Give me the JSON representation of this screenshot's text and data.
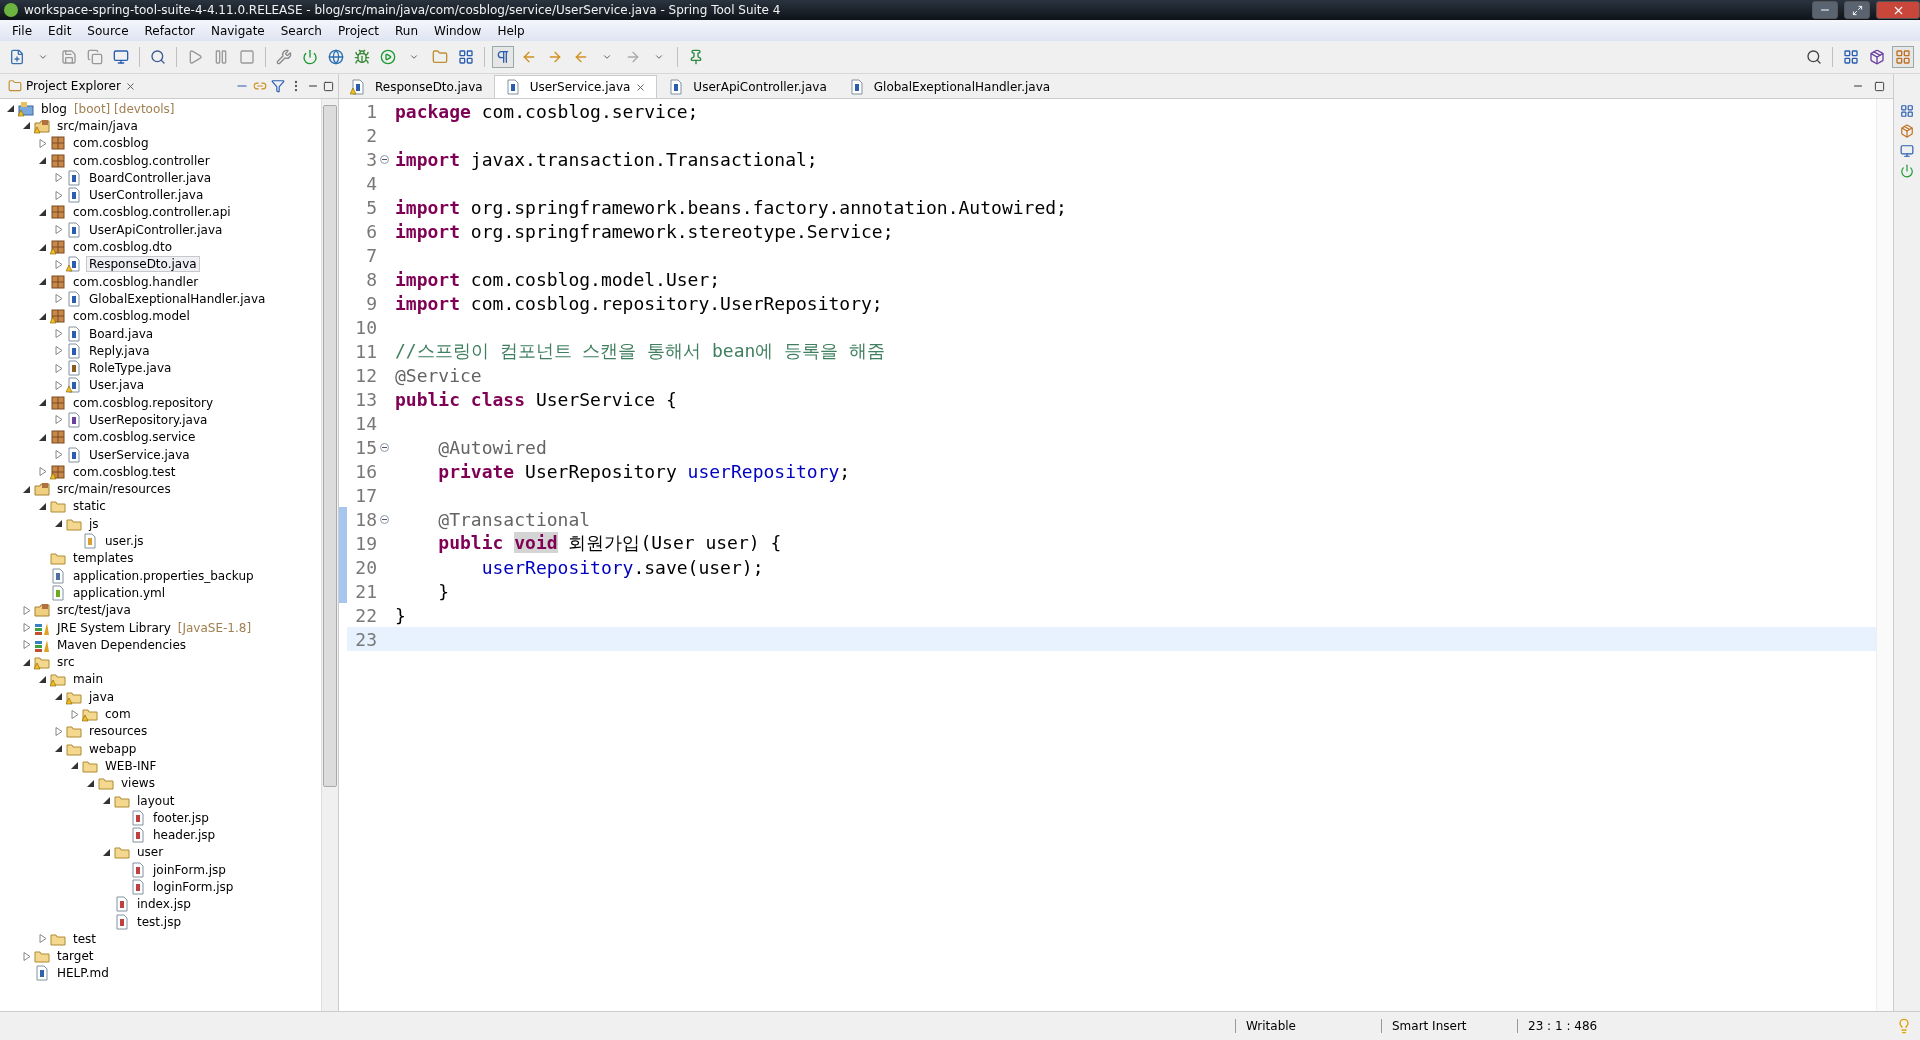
{
  "window": {
    "title": "workspace-spring-tool-suite-4-4.11.0.RELEASE - blog/src/main/java/com/cosblog/service/UserService.java - Spring Tool Suite 4"
  },
  "menu": [
    "File",
    "Edit",
    "Source",
    "Refactor",
    "Navigate",
    "Search",
    "Project",
    "Run",
    "Window",
    "Help"
  ],
  "explorer": {
    "title": "Project Explorer",
    "tree": [
      {
        "label": "blog",
        "suffix": "[boot] [devtools]",
        "kind": "project",
        "expanded": true,
        "warning": true,
        "selected": false,
        "children": [
          {
            "label": "src/main/java",
            "kind": "source",
            "expanded": true,
            "warning": true,
            "selected": false,
            "children": [
              {
                "label": "com.cosblog",
                "kind": "package",
                "expanded": false,
                "warning": false,
                "selected": false
              },
              {
                "label": "com.cosblog.controller",
                "kind": "package",
                "expanded": true,
                "warning": false,
                "selected": false,
                "children": [
                  {
                    "label": "BoardController.java",
                    "kind": "java",
                    "expanded": false,
                    "warning": false,
                    "selected": false
                  },
                  {
                    "label": "UserController.java",
                    "kind": "java",
                    "expanded": false,
                    "warning": false,
                    "selected": false
                  }
                ]
              },
              {
                "label": "com.cosblog.controller.api",
                "kind": "package",
                "expanded": true,
                "warning": false,
                "selected": false,
                "children": [
                  {
                    "label": "UserApiController.java",
                    "kind": "java",
                    "expanded": false,
                    "warning": false,
                    "selected": false
                  }
                ]
              },
              {
                "label": "com.cosblog.dto",
                "kind": "package",
                "expanded": true,
                "warning": true,
                "selected": false,
                "children": [
                  {
                    "label": "ResponseDto.java",
                    "kind": "java",
                    "expanded": false,
                    "warning": true,
                    "selected": true
                  }
                ]
              },
              {
                "label": "com.cosblog.handler",
                "kind": "package",
                "expanded": true,
                "warning": false,
                "selected": false,
                "children": [
                  {
                    "label": "GlobalExeptionalHandler.java",
                    "kind": "java",
                    "expanded": false,
                    "warning": false,
                    "selected": false
                  }
                ]
              },
              {
                "label": "com.cosblog.model",
                "kind": "package",
                "expanded": true,
                "warning": true,
                "selected": false,
                "children": [
                  {
                    "label": "Board.java",
                    "kind": "java",
                    "expanded": false,
                    "warning": false,
                    "selected": false
                  },
                  {
                    "label": "Reply.java",
                    "kind": "java",
                    "expanded": false,
                    "warning": false,
                    "selected": false
                  },
                  {
                    "label": "RoleType.java",
                    "kind": "enum",
                    "expanded": false,
                    "warning": false,
                    "selected": false
                  },
                  {
                    "label": "User.java",
                    "kind": "java",
                    "expanded": false,
                    "warning": true,
                    "selected": false
                  }
                ]
              },
              {
                "label": "com.cosblog.repository",
                "kind": "package",
                "expanded": true,
                "warning": false,
                "selected": false,
                "children": [
                  {
                    "label": "UserRepository.java",
                    "kind": "interface",
                    "expanded": false,
                    "warning": false,
                    "selected": false
                  }
                ]
              },
              {
                "label": "com.cosblog.service",
                "kind": "package",
                "expanded": true,
                "warning": false,
                "selected": false,
                "children": [
                  {
                    "label": "UserService.java",
                    "kind": "java",
                    "expanded": false,
                    "warning": false,
                    "selected": false
                  }
                ]
              },
              {
                "label": "com.cosblog.test",
                "kind": "package",
                "expanded": false,
                "warning": true,
                "selected": false
              }
            ]
          },
          {
            "label": "src/main/resources",
            "kind": "source",
            "expanded": true,
            "warning": false,
            "selected": false,
            "children": [
              {
                "label": "static",
                "kind": "folder",
                "expanded": true,
                "warning": false,
                "selected": false,
                "children": [
                  {
                    "label": "js",
                    "kind": "folder",
                    "expanded": true,
                    "warning": false,
                    "selected": false,
                    "children": [
                      {
                        "label": "user.js",
                        "kind": "js",
                        "warning": false,
                        "selected": false
                      }
                    ]
                  }
                ]
              },
              {
                "label": "templates",
                "kind": "folder",
                "warning": false,
                "selected": false
              },
              {
                "label": "application.properties_backup",
                "kind": "text",
                "warning": false,
                "selected": false
              },
              {
                "label": "application.yml",
                "kind": "yml",
                "warning": false,
                "selected": false
              }
            ]
          },
          {
            "label": "src/test/java",
            "kind": "source",
            "expanded": false,
            "warning": false,
            "selected": false
          },
          {
            "label": "JRE System Library",
            "suffix": "[JavaSE-1.8]",
            "kind": "library",
            "expanded": false,
            "warning": false,
            "selected": false
          },
          {
            "label": "Maven Dependencies",
            "kind": "library",
            "expanded": false,
            "warning": false,
            "selected": false
          },
          {
            "label": "src",
            "kind": "folder",
            "expanded": true,
            "warning": true,
            "selected": false,
            "children": [
              {
                "label": "main",
                "kind": "folder",
                "expanded": true,
                "warning": true,
                "selected": false,
                "children": [
                  {
                    "label": "java",
                    "kind": "folder",
                    "expanded": true,
                    "warning": true,
                    "selected": false,
                    "children": [
                      {
                        "label": "com",
                        "kind": "folder",
                        "expanded": false,
                        "warning": true,
                        "selected": false
                      }
                    ]
                  },
                  {
                    "label": "resources",
                    "kind": "folder",
                    "expanded": false,
                    "warning": false,
                    "selected": false
                  },
                  {
                    "label": "webapp",
                    "kind": "folder",
                    "expanded": true,
                    "warning": false,
                    "selected": false,
                    "children": [
                      {
                        "label": "WEB-INF",
                        "kind": "folder",
                        "expanded": true,
                        "warning": false,
                        "selected": false,
                        "children": [
                          {
                            "label": "views",
                            "kind": "folder",
                            "expanded": true,
                            "warning": false,
                            "selected": false,
                            "children": [
                              {
                                "label": "layout",
                                "kind": "folder",
                                "expanded": true,
                                "warning": false,
                                "selected": false,
                                "children": [
                                  {
                                    "label": "footer.jsp",
                                    "kind": "jsp",
                                    "warning": false,
                                    "selected": false
                                  },
                                  {
                                    "label": "header.jsp",
                                    "kind": "jsp",
                                    "warning": false,
                                    "selected": false
                                  }
                                ]
                              },
                              {
                                "label": "user",
                                "kind": "folder",
                                "expanded": true,
                                "warning": false,
                                "selected": false,
                                "children": [
                                  {
                                    "label": "joinForm.jsp",
                                    "kind": "jsp",
                                    "warning": false,
                                    "selected": false
                                  },
                                  {
                                    "label": "loginForm.jsp",
                                    "kind": "jsp",
                                    "warning": false,
                                    "selected": false
                                  }
                                ]
                              },
                              {
                                "label": "index.jsp",
                                "kind": "jsp",
                                "warning": false,
                                "selected": false
                              },
                              {
                                "label": "test.jsp",
                                "kind": "jsp",
                                "warning": false,
                                "selected": false
                              }
                            ]
                          }
                        ]
                      }
                    ]
                  }
                ]
              },
              {
                "label": "test",
                "kind": "folder",
                "expanded": false,
                "warning": false,
                "selected": false
              }
            ]
          },
          {
            "label": "target",
            "kind": "folder",
            "expanded": false,
            "warning": false,
            "selected": false
          },
          {
            "label": "HELP.md",
            "kind": "md",
            "warning": false,
            "selected": false
          }
        ]
      }
    ]
  },
  "tabs": [
    {
      "label": "ResponseDto.java",
      "selected": false,
      "warning": true
    },
    {
      "label": "UserService.java",
      "selected": true,
      "warning": false
    },
    {
      "label": "UserApiController.java",
      "selected": false,
      "warning": false
    },
    {
      "label": "GlobalExeptionalHandler.java",
      "selected": false,
      "warning": false
    }
  ],
  "code": [
    {
      "number": "1",
      "tokens": [
        {
          "kind": "keyword",
          "text": "package"
        },
        {
          "kind": "plain",
          "text": " com.cosblog.service;"
        }
      ]
    },
    {
      "number": "2"
    },
    {
      "number": "3",
      "fold": true,
      "tokens": [
        {
          "kind": "keyword",
          "text": "import"
        },
        {
          "kind": "plain",
          "text": " javax.transaction.Transactional;"
        }
      ]
    },
    {
      "number": "4"
    },
    {
      "number": "5",
      "tokens": [
        {
          "kind": "keyword",
          "text": "import"
        },
        {
          "kind": "plain",
          "text": " org.springframework.beans.factory.annotation.Autowired;"
        }
      ]
    },
    {
      "number": "6",
      "tokens": [
        {
          "kind": "keyword",
          "text": "import"
        },
        {
          "kind": "plain",
          "text": " org.springframework.stereotype.Service;"
        }
      ]
    },
    {
      "number": "7"
    },
    {
      "number": "8",
      "tokens": [
        {
          "kind": "keyword",
          "text": "import"
        },
        {
          "kind": "plain",
          "text": " com.cosblog.model.User;"
        }
      ]
    },
    {
      "number": "9",
      "tokens": [
        {
          "kind": "keyword",
          "text": "import"
        },
        {
          "kind": "plain",
          "text": " com.cosblog.repository.UserRepository;"
        }
      ]
    },
    {
      "number": "10"
    },
    {
      "number": "11",
      "tokens": [
        {
          "kind": "comment",
          "text": "//스프링이 컴포넌트 스캔을 통해서 bean에 등록을 해줌"
        }
      ]
    },
    {
      "number": "12",
      "tokens": [
        {
          "kind": "annotation",
          "text": "@Service"
        }
      ]
    },
    {
      "number": "13",
      "tokens": [
        {
          "kind": "keyword",
          "text": "public class"
        },
        {
          "kind": "plain",
          "text": " UserService {"
        }
      ]
    },
    {
      "number": "14"
    },
    {
      "number": "15",
      "fold": true,
      "tokens": [
        {
          "kind": "annotation",
          "text": "    @Autowired"
        }
      ]
    },
    {
      "number": "16",
      "tokens": [
        {
          "kind": "keyword",
          "text": "    private"
        },
        {
          "kind": "plain",
          "text": " UserRepository "
        },
        {
          "kind": "field",
          "text": "userRepository"
        },
        {
          "kind": "plain",
          "text": ";"
        }
      ]
    },
    {
      "number": "17"
    },
    {
      "number": "18",
      "fold": true,
      "changed": true,
      "tokens": [
        {
          "kind": "annotation",
          "text": "    @Transactional"
        }
      ]
    },
    {
      "number": "19",
      "changed": true,
      "tokens": [
        {
          "kind": "keyword",
          "text": "    public "
        },
        {
          "kind": "occurrence",
          "text": "void"
        },
        {
          "kind": "plain",
          "text": " 회원가입(User user) {"
        }
      ]
    },
    {
      "number": "20",
      "changed": true,
      "tokens": [
        {
          "kind": "field",
          "text": "        userRepository"
        },
        {
          "kind": "plain",
          "text": ".save(user);"
        }
      ]
    },
    {
      "number": "21",
      "changed": true,
      "tokens": [
        {
          "kind": "bracket",
          "text": "    }"
        }
      ]
    },
    {
      "number": "22",
      "tokens": [
        {
          "kind": "plain",
          "text": "}"
        }
      ]
    },
    {
      "number": "23",
      "current": true
    }
  ],
  "status_bar": {
    "mode": "Writable",
    "insert": "Smart Insert",
    "position": "23 : 1 : 486"
  }
}
